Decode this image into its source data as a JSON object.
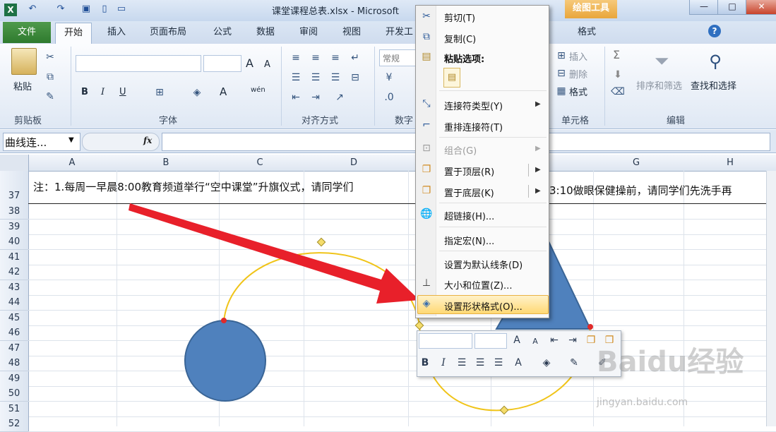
{
  "window": {
    "title": "课堂课程总表.xlsx - Microsoft",
    "contextual_group": "绘图工具"
  },
  "tabs": {
    "file": "文件",
    "home": "开始",
    "insert": "插入",
    "layout": "页面布局",
    "formulas": "公式",
    "data": "数据",
    "review": "审阅",
    "view": "视图",
    "developer": "开发工",
    "format": "格式"
  },
  "ribbon": {
    "paste": "粘贴",
    "clipboard": "剪贴板",
    "font": "字体",
    "alignment": "对齐方式",
    "number_short": "数字",
    "number_format": "常规",
    "insert": "插入",
    "delete": "删除",
    "format": "格式",
    "cells": "单元格",
    "sort_filter": "排序和筛选",
    "find_select": "查找和选择",
    "editing": "编辑",
    "bold": "B",
    "italic": "I",
    "underline": "U",
    "font_grow": "A",
    "font_shrink": "A",
    "font_color": "A",
    "phonetic": "wén",
    "sigma": "Σ"
  },
  "formula_bar": {
    "name_box": "曲线连...",
    "fx": "fx",
    "value": ""
  },
  "columns": [
    "A",
    "B",
    "C",
    "D",
    "G",
    "H"
  ],
  "rows": [
    "37",
    "38",
    "39",
    "40",
    "41",
    "42",
    "43",
    "44",
    "45",
    "46",
    "47",
    "48",
    "49",
    "50",
    "51",
    "52"
  ],
  "row37": "注：1.每周一早晨8:00教育频道举行“空中课堂”升旗仪式，请同学们",
  "row37_tail": "3:10做眼保健操前，请同学们先洗手再",
  "context_menu": {
    "cut": "剪切(T)",
    "copy": "复制(C)",
    "paste_options": "粘贴选项:",
    "connector_type": "连接符类型(Y)",
    "reroute": "重排连接符(T)",
    "group": "组合(G)",
    "bring_front": "置于顶层(R)",
    "send_back": "置于底层(K)",
    "hyperlink": "超链接(H)...",
    "assign_macro": "指定宏(N)...",
    "set_default": "设置为默认线条(D)",
    "size_position": "大小和位置(Z)...",
    "format_shape": "设置形状格式(O)..."
  },
  "mini_toolbar": {
    "bold": "B",
    "italic": "I",
    "font_color": "A"
  },
  "watermark": {
    "brand": "Baidu经验",
    "url": "jingyan.baidu.com"
  },
  "colors": {
    "shape_fill": "#4f81bd",
    "connector": "#f0c419",
    "arrow": "#e8202a",
    "excel_green": "#2e7a2e"
  }
}
